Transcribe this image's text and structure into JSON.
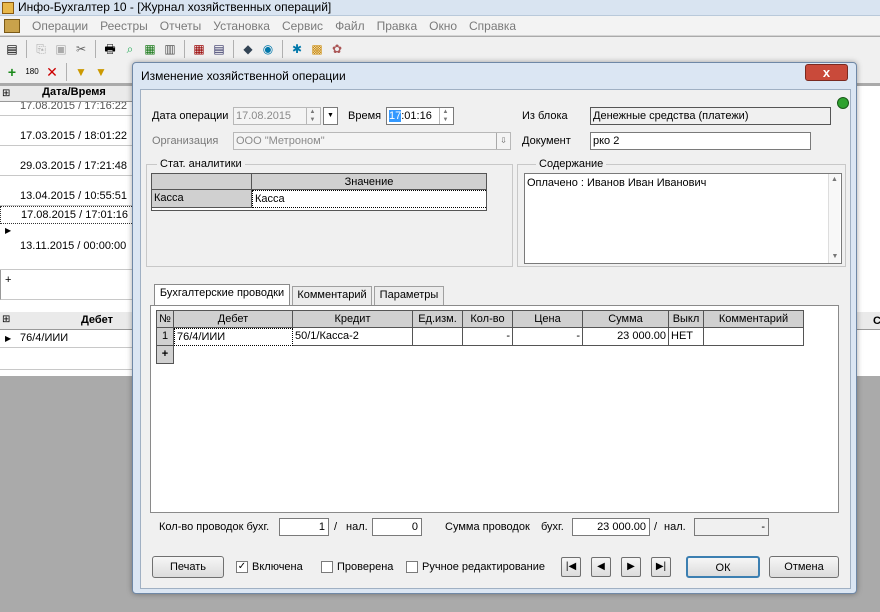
{
  "app": {
    "title": "Инфо-Бухгалтер 10 - [Журнал хозяйственных операций]",
    "menu": [
      "Операции",
      "Реестры",
      "Отчеты",
      "Установка",
      "Сервис",
      "Файл",
      "Правка",
      "Окно",
      "Справка"
    ]
  },
  "background": {
    "table_header": "Дата/Время",
    "rows": [
      "17.08.2015 / 17:16:22",
      "17.03.2015 / 18:01:22",
      "29.03.2015 / 17:21:48",
      "13.04.2015 / 10:55:51",
      "17.08.2015 / 17:01:16",
      "13.11.2015 / 00:00:00"
    ],
    "add_label": "+",
    "bottom_header": "Дебет",
    "bottom_row": "76/4/ИИИ",
    "right_col_label": "С"
  },
  "dialog": {
    "title": "Изменение хозяйственной операции",
    "close_label": "x",
    "date_label": "Дата операции",
    "date_value": "17.08.2015",
    "time_label": "Время",
    "time_value_sel": "17",
    "time_value_rest": ":01:16",
    "from_block_label": "Из блока",
    "from_block_value": "Денежные средства (платежи)",
    "org_label": "Организация",
    "org_value": "ООО \"Метроном\"",
    "doc_label": "Документ",
    "doc_value": "рко 2",
    "analytics": {
      "group_label": "Стат. аналитики",
      "col_value": "Значение",
      "row_name": "Касса",
      "row_value": "Касса"
    },
    "content": {
      "group_label": "Содержание",
      "text": "Оплачено : Иванов Иван Иванович"
    },
    "tabs": [
      "Бухгалтерские проводки",
      "Комментарий",
      "Параметры"
    ],
    "postings": {
      "columns": [
        "№",
        "Дебет",
        "Кредит",
        "Ед.изм.",
        "Кол-во",
        "Цена",
        "Сумма",
        "Выкл",
        "Комментарий"
      ],
      "rows": [
        {
          "num": "1",
          "debit": "76/4/ИИИ",
          "credit": "50/1/Касса-2",
          "unit": "",
          "qty": "-",
          "price": "-",
          "sum": "23 000.00",
          "off": "НЕТ",
          "comment": ""
        }
      ],
      "add_label": "+"
    },
    "summary": {
      "count_label": "Кол-во проводок  бухг.",
      "count_acc": "1",
      "slash1": "/",
      "tax_label": "нал.",
      "count_tax": "0",
      "sum_label": "Сумма проводок",
      "sum_acc_label": "бухг.",
      "sum_acc": "23 000.00",
      "slash2": "/",
      "sum_tax_label": "нал.",
      "sum_tax": "-"
    },
    "buttons": {
      "print": "Печать",
      "ok": "ОК",
      "cancel": "Отмена"
    },
    "checks": {
      "enabled": {
        "label": "Включена",
        "checked": "✓"
      },
      "verified": {
        "label": "Проверена",
        "checked": ""
      },
      "manual": {
        "label": "Ручное редактирование",
        "checked": ""
      }
    },
    "nav": {
      "first": "|◀",
      "prev": "◀",
      "next": "▶",
      "last": "▶|"
    },
    "status_color": "#2fa22f"
  }
}
